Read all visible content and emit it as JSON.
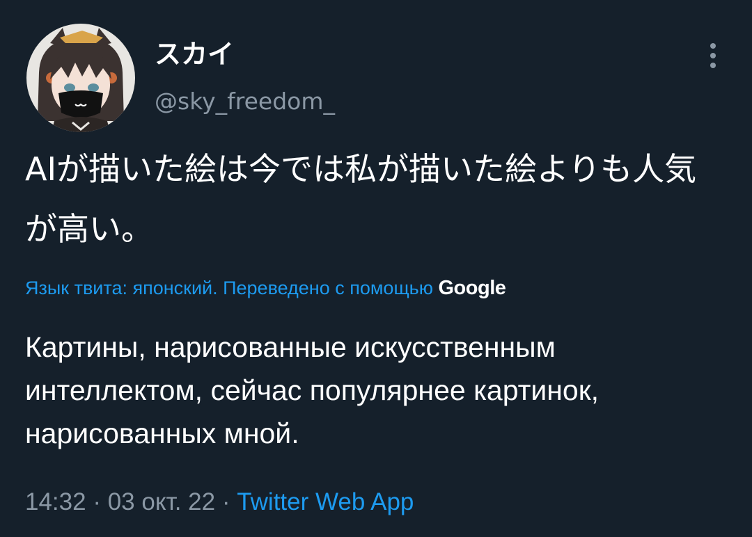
{
  "author": {
    "display_name": "スカイ",
    "handle": "@sky_freedom_"
  },
  "tweet": {
    "text": "AIが描いた絵は今では私が描いた絵よりも人気が高い。",
    "translation": {
      "notice": "Язык твита: японский. Переведено с помощью",
      "provider": "Google",
      "text": "Картины, нарисованные искусственным интеллектом, сейчас популярнее картинок, нарисованных мной."
    },
    "time": "14:32",
    "date": "03 окт. 22",
    "separator": "·",
    "source": "Twitter Web App"
  },
  "icons": {
    "menu": "more-vertical-icon"
  },
  "colors": {
    "background": "#15202b",
    "primary_text": "#ffffff",
    "secondary_text": "#8b98a5",
    "accent": "#1d9bf0"
  }
}
